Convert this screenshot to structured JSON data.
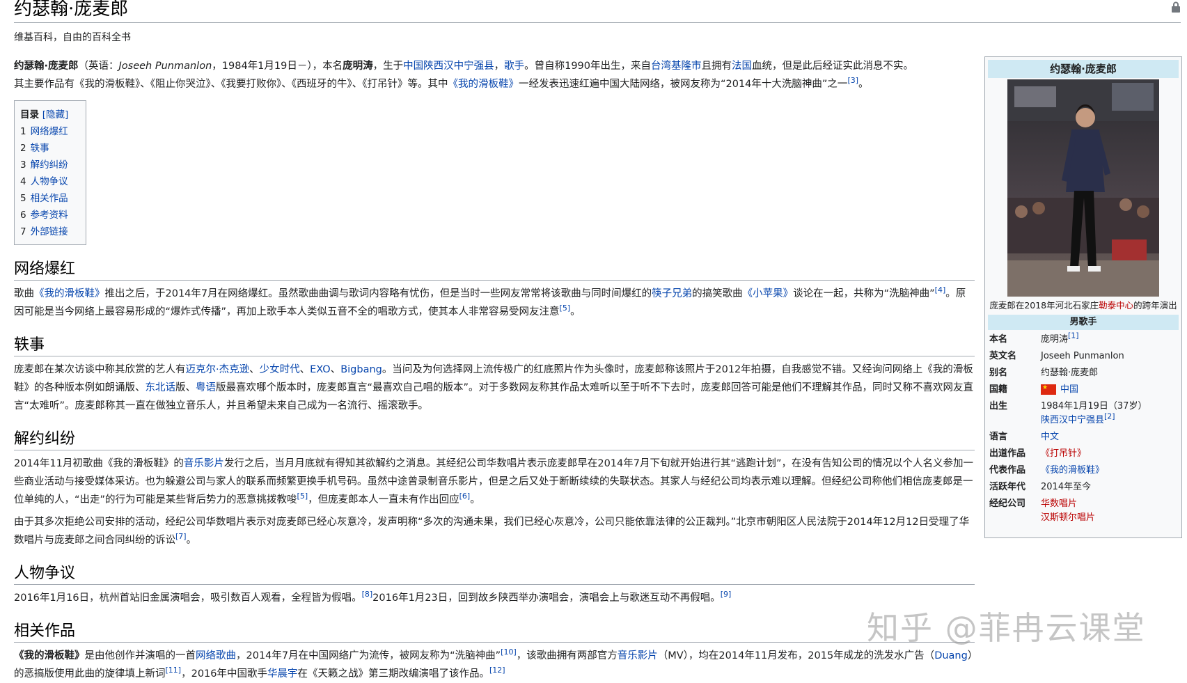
{
  "page": {
    "title": "约瑟翰·庞麦郎",
    "tagline": "维基百科，自由的百科全书"
  },
  "intro": {
    "p1_bold": "约瑟翰·庞麦郎",
    "p1_a": "（英语：",
    "p1_en": "Joseeh Punmanlon",
    "p1_b": "，1984年1月19日－），本名",
    "p1_real": "庞明涛",
    "p1_c": "，生于",
    "p1_link1": "中国陕西汉中宁强县",
    "p1_d": "，",
    "p1_link2": "歌手",
    "p1_e": "。曾自称1990年出生，来自",
    "p1_link3": "台湾基隆市",
    "p1_f": "且拥有",
    "p1_link4": "法国",
    "p1_g": "血统，但是此后经证实此消息不实。",
    "p2_a": "其主要作品有《我的滑板鞋》、《阻止你哭泣》、《我要打败你》、《西班牙的牛》、《打吊针》等。其中",
    "p2_link": "《我的滑板鞋》",
    "p2_b": "一经发表迅速红遍中国大陆网络，被网友称为“2014年十大洗脑神曲”之一",
    "p2_ref": "[3]",
    "p2_c": "。"
  },
  "toc": {
    "title": "目录",
    "toggle": "[隐藏]",
    "items": [
      {
        "num": "1",
        "label": "网络爆红"
      },
      {
        "num": "2",
        "label": "轶事"
      },
      {
        "num": "3",
        "label": "解约纠纷"
      },
      {
        "num": "4",
        "label": "人物争议"
      },
      {
        "num": "5",
        "label": "相关作品"
      },
      {
        "num": "6",
        "label": "参考资料"
      },
      {
        "num": "7",
        "label": "外部链接"
      }
    ]
  },
  "sections": {
    "s1": {
      "heading": "网络爆红",
      "a": "歌曲",
      "link1": "《我的滑板鞋》",
      "b": "推出之后，于2014年7月在网络爆红。虽然歌曲曲调与歌词内容略有忧伤，但是当时一些网友常常将该歌曲与同时间爆红的",
      "link2": "筷子兄弟",
      "c": "的搞笑歌曲",
      "link3": "《小苹果》",
      "d": "谈论在一起，共称为“洗脑神曲”",
      "ref1": "[4]",
      "e": "。原因可能是当今网络上最容易形成的“爆炸式传播”，再加上歌手本人类似五音不全的唱歌方式，使其本人非常容易受网友注意",
      "ref2": "[5]",
      "f": "。"
    },
    "s2": {
      "heading": "轶事",
      "a": "庞麦郎在某次访谈中称其欣赏的艺人有",
      "link1": "迈克尔·杰克逊",
      "sep1": "、",
      "link2": "少女时代",
      "sep2": "、",
      "link3": "EXO",
      "sep3": "、",
      "link4": "Bigbang",
      "b": "。当问及为何选择网上流传极广的红底照片作为头像时，庞麦郎称该照片于2012年拍摄，自我感觉不错。又经询问网络上《我的滑板鞋》的各种版本例如朗诵版、",
      "link5": "东北话",
      "c": "版、",
      "link6": "粤语",
      "d": "版最喜欢哪个版本时，庞麦郎直言“最喜欢自己唱的版本”。对于多数网友称其作品太难听以至于听不下去时，庞麦郎回答可能是他们不理解其作品，同时又称不喜欢网友直言“太难听”。庞麦郎称其一直在做独立音乐人，并且希望未来自己成为一名流行、摇滚歌手。"
    },
    "s3": {
      "heading": "解约纠纷",
      "a": "2014年11月初歌曲《我的滑板鞋》的",
      "link1": "音乐影片",
      "b": "发行之后，当月月底就有得知其欲解约之消息。其经纪公司华数唱片表示庞麦郎早在2014年7月下旬就开始进行其“逃跑计划”，在没有告知公司的情况以个人名义参加一些商业活动与接受媒体采访。也为躲避公司与家人的联系而频繁更换手机号码。虽然中途曾录制音乐影片，但是之后又处于断断续续的失联状态。其家人与经纪公司均表示难以理解。但经纪公司称他们相信庞麦郎是一位单纯的人，“出走”的行为可能是某些背后势力的恶意挑拨教唆",
      "ref1": "[5]",
      "c": "，但庞麦郎本人一直未有作出回应",
      "ref2": "[6]",
      "d": "。",
      "p2": "由于其多次拒绝公司安排的活动，经纪公司华数唱片表示对庞麦郎已经心灰意冷，发声明称“多次的沟通未果，我们已经心灰意冷，公司只能依靠法律的公正裁判。”北京市朝阳区人民法院于2014年12月12日受理了华数唱片与庞麦郎之间合同纠纷的诉讼",
      "ref3": "[7]",
      "e": "。"
    },
    "s4": {
      "heading": "人物争议",
      "a": "2016年1月16日，杭州首站旧金属演唱会，吸引数百人观看，全程皆为假唱。",
      "ref1": "[8]",
      "b": "2016年1月23日，回到故乡陕西举办演唱会，演唱会上与歌迷互动不再假唱。",
      "ref2": "[9]"
    },
    "s5": {
      "heading": "相关作品",
      "bold": "《我的滑板鞋》",
      "a": "是由他创作并演唱的一首",
      "link1": "网络歌曲",
      "b": "，2014年7月在中国网络广为流传，被网友称为“洗脑神曲”",
      "ref1": "[10]",
      "c": "，该歌曲拥有两部官方",
      "link2": "音乐影片",
      "d": "（MV），均在2014年11月发布，2015年成龙的洗发水广告（",
      "link3": "Duang",
      "e": "）的恶搞版使用此曲的旋律填上新词",
      "ref2": "[11]",
      "f": "，2016年中国歌手",
      "link4": "华晨宇",
      "g": "在《天籁之战》第三期改编演唱了该作品。",
      "ref3": "[12]"
    }
  },
  "infobox": {
    "title": "约瑟翰·庞麦郎",
    "caption_a": "庞麦郎在2018年河北石家庄",
    "caption_link": "勒泰中心",
    "caption_b": "的跨年演出",
    "header": "男歌手",
    "rows": {
      "real_name_label": "本名",
      "real_name": "庞明涛",
      "real_name_ref": "[1]",
      "en_name_label": "英文名",
      "en_name": "Joseeh Punmanlon",
      "alias_label": "别名",
      "alias": "约瑟翰·庞麦郎",
      "nationality_label": "国籍",
      "nationality": "中国",
      "born_label": "出生",
      "born": "1984年1月19日（37岁）",
      "born_place": "陕西汉中宁强县",
      "born_ref": "[2]",
      "language_label": "语言",
      "language": "中文",
      "debut_label": "出道作品",
      "debut": "《打吊针》",
      "works_label": "代表作品",
      "works": "《我的滑板鞋》",
      "active_label": "活跃年代",
      "active": "2014年至今",
      "agency_label": "经纪公司",
      "agency1": "华数唱片",
      "agency2": "汉斯顿尔唱片"
    }
  },
  "watermark": "知乎 @菲冉云课堂",
  "colors": {
    "link": "#0645ad",
    "redlink": "#ba0000",
    "infobox_header": "#cfe9f3"
  }
}
